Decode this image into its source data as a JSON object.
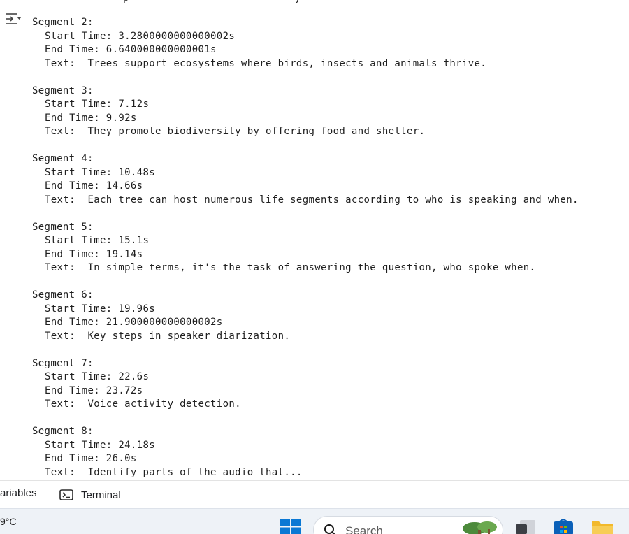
{
  "cutoff_text": "p                           y",
  "segments": [
    {
      "header": "Segment 2:",
      "start": "Start Time: 3.2800000000000002s",
      "end": "End Time: 6.640000000000001s",
      "text": "Text:  Trees support ecosystems where birds, insects and animals thrive."
    },
    {
      "header": "Segment 3:",
      "start": "Start Time: 7.12s",
      "end": "End Time: 9.92s",
      "text": "Text:  They promote biodiversity by offering food and shelter."
    },
    {
      "header": "Segment 4:",
      "start": "Start Time: 10.48s",
      "end": "End Time: 14.66s",
      "text": "Text:  Each tree can host numerous life segments according to who is speaking and when."
    },
    {
      "header": "Segment 5:",
      "start": "Start Time: 15.1s",
      "end": "End Time: 19.14s",
      "text": "Text:  In simple terms, it's the task of answering the question, who spoke when."
    },
    {
      "header": "Segment 6:",
      "start": "Start Time: 19.96s",
      "end": "End Time: 21.900000000000002s",
      "text": "Text:  Key steps in speaker diarization."
    },
    {
      "header": "Segment 7:",
      "start": "Start Time: 22.6s",
      "end": "End Time: 23.72s",
      "text": "Text:  Voice activity detection."
    },
    {
      "header": "Segment 8:",
      "start": "Start Time: 24.18s",
      "end": "End Time: 26.0s",
      "text": "Text:  Identify parts of the audio that..."
    }
  ],
  "panel_tabs": {
    "variables": "ariables",
    "terminal": "Terminal"
  },
  "taskbar": {
    "weather": "9°C",
    "search_placeholder": "Search",
    "icons": [
      "windows-start-icon",
      "search-icon",
      "task-view-icon",
      "store-icon",
      "file-explorer-icon"
    ]
  },
  "colors": {
    "panel_bg": "#ffffff",
    "taskbar_bg": "#eef2f7",
    "windows_blue": "#0a78d4",
    "folder_yellow": "#f2b92b"
  }
}
